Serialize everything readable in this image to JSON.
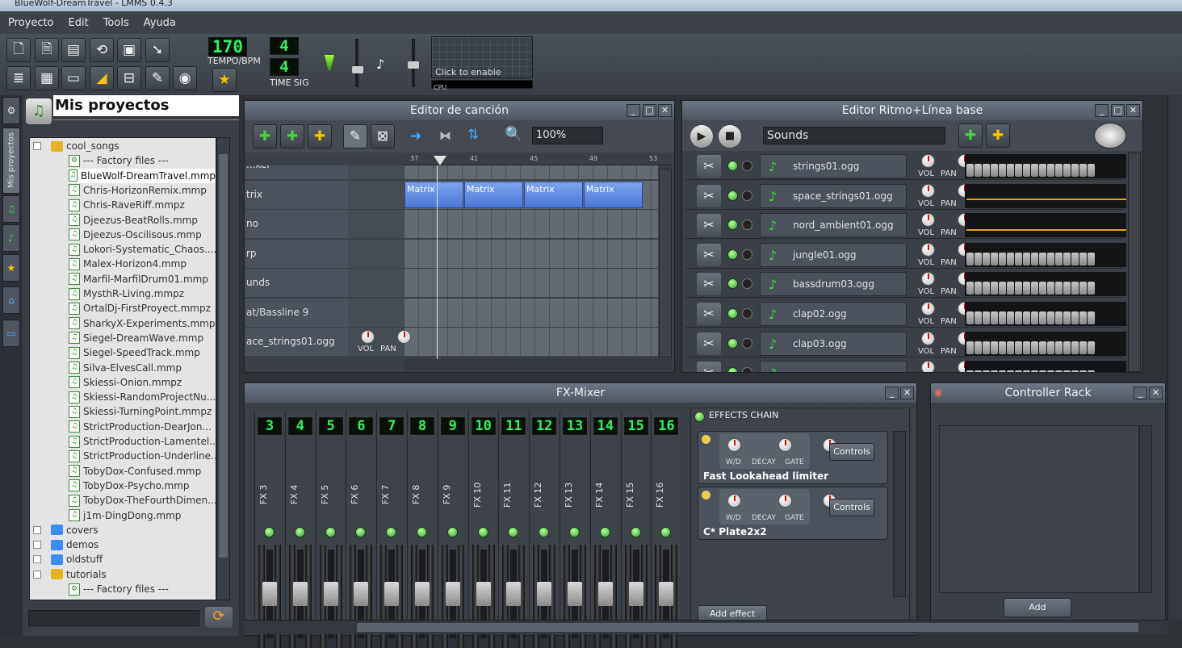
{
  "window": {
    "title": "BlueWolf-DreamTravel - LMMS 0.4.3"
  },
  "menu": [
    "Proyecto",
    "Edit",
    "Tools",
    "Ayuda"
  ],
  "toolbar": {
    "tempo_value": "170",
    "tempo_label": "TEMPO/BPM",
    "timesig_top": "4",
    "timesig_bottom": "4",
    "timesig_label": "TIME SIG",
    "visualizer_text": "Click to enable",
    "cpu_label": "CPU"
  },
  "browser": {
    "title": "Mis proyectos",
    "side_tab_label": "Mis proyectos",
    "search_value": "",
    "items": [
      {
        "label": "cool_songs",
        "type": "folder-open",
        "indent": 0
      },
      {
        "label": "--- Factory files ---",
        "type": "factory",
        "indent": 1
      },
      {
        "label": "BlueWolf-DreamTravel.mmp",
        "type": "file",
        "indent": 1,
        "selected": true
      },
      {
        "label": "Chris-HorizonRemix.mmp",
        "type": "file",
        "indent": 1
      },
      {
        "label": "Chris-RaveRiff.mmpz",
        "type": "file",
        "indent": 1
      },
      {
        "label": "Djeezus-BeatRolls.mmp",
        "type": "file",
        "indent": 1
      },
      {
        "label": "Djeezus-Oscilisous.mmp",
        "type": "file",
        "indent": 1
      },
      {
        "label": "Lokori-Systematic_Chaos....",
        "type": "file",
        "indent": 1
      },
      {
        "label": "Malex-Horizon4.mmp",
        "type": "file",
        "indent": 1
      },
      {
        "label": "Marfil-MarfilDrum01.mmp",
        "type": "file",
        "indent": 1
      },
      {
        "label": "MysthR-Living.mmpz",
        "type": "file",
        "indent": 1
      },
      {
        "label": "OrtalDj-FirstProyect.mmpz",
        "type": "file",
        "indent": 1
      },
      {
        "label": "SharkyX-Experiments.mmp",
        "type": "file",
        "indent": 1
      },
      {
        "label": "Siegel-DreamWave.mmp",
        "type": "file",
        "indent": 1
      },
      {
        "label": "Siegel-SpeedTrack.mmp",
        "type": "file",
        "indent": 1
      },
      {
        "label": "Silva-ElvesCall.mmp",
        "type": "file",
        "indent": 1
      },
      {
        "label": "Skiessi-Onion.mmpz",
        "type": "file",
        "indent": 1
      },
      {
        "label": "Skiessi-RandomProjectNu...",
        "type": "file",
        "indent": 1
      },
      {
        "label": "Skiessi-TurningPoint.mmpz",
        "type": "file",
        "indent": 1
      },
      {
        "label": "StrictProduction-DearJon...",
        "type": "file",
        "indent": 1
      },
      {
        "label": "StrictProduction-Lamentel...",
        "type": "file",
        "indent": 1
      },
      {
        "label": "StrictProduction-Underline...",
        "type": "file",
        "indent": 1
      },
      {
        "label": "TobyDox-Confused.mmp",
        "type": "file",
        "indent": 1
      },
      {
        "label": "TobyDox-Psycho.mmp",
        "type": "file",
        "indent": 1
      },
      {
        "label": "TobyDox-TheFourthDimen...",
        "type": "file",
        "indent": 1
      },
      {
        "label": "j1m-DingDong.mmp",
        "type": "file",
        "indent": 1
      },
      {
        "label": "covers",
        "type": "folder",
        "indent": 0
      },
      {
        "label": "demos",
        "type": "folder",
        "indent": 0
      },
      {
        "label": "oldstuff",
        "type": "folder",
        "indent": 0
      },
      {
        "label": "tutorials",
        "type": "folder-open",
        "indent": 0
      },
      {
        "label": "--- Factory files ---",
        "type": "factory",
        "indent": 1
      }
    ]
  },
  "song_editor": {
    "title": "Editor de canción",
    "zoom": "100%",
    "ruler": [
      "37",
      "41",
      "45",
      "49",
      "53"
    ],
    "tracks": [
      "...ker",
      "trix",
      "no",
      "rp",
      "unds",
      "at/Bassline 9",
      "ace_strings01.ogg"
    ],
    "pattern_label": "Matrix",
    "vol_label": "VOL",
    "pan_label": "PAN"
  },
  "beat_editor": {
    "title": "Editor Ritmo+Línea base",
    "combo": "Sounds",
    "vol_label": "VOL",
    "pan_label": "PAN",
    "rows": [
      "strings01.ogg",
      "space_strings01.ogg",
      "nord_ambient01.ogg",
      "jungle01.ogg",
      "bassdrum03.ogg",
      "clap02.ogg",
      "clap03.ogg",
      "..."
    ]
  },
  "fx_mixer": {
    "title": "FX-Mixer",
    "channels": [
      {
        "num": "3",
        "name": "FX 3"
      },
      {
        "num": "4",
        "name": "FX 4"
      },
      {
        "num": "5",
        "name": "FX 5"
      },
      {
        "num": "6",
        "name": "FX 6"
      },
      {
        "num": "7",
        "name": "FX 7"
      },
      {
        "num": "8",
        "name": "FX 8"
      },
      {
        "num": "9",
        "name": "FX 9"
      },
      {
        "num": "10",
        "name": "FX 10"
      },
      {
        "num": "11",
        "name": "FX 11"
      },
      {
        "num": "12",
        "name": "FX 12"
      },
      {
        "num": "13",
        "name": "FX 13"
      },
      {
        "num": "14",
        "name": "FX 14"
      },
      {
        "num": "15",
        "name": "FX 15"
      },
      {
        "num": "16",
        "name": "FX 16"
      }
    ],
    "effects_chain_label": "EFFECTS CHAIN",
    "effects": [
      {
        "name": "Fast Lookahead limiter",
        "knobs": [
          "W/D",
          "DECAY",
          "GATE"
        ],
        "controls": "Controls"
      },
      {
        "name": "C* Plate2x2",
        "knobs": [
          "W/D",
          "DECAY",
          "GATE"
        ],
        "controls": "Controls"
      }
    ],
    "add_effect": "Add effect"
  },
  "controller_rack": {
    "title": "Controller Rack",
    "add": "Add"
  }
}
